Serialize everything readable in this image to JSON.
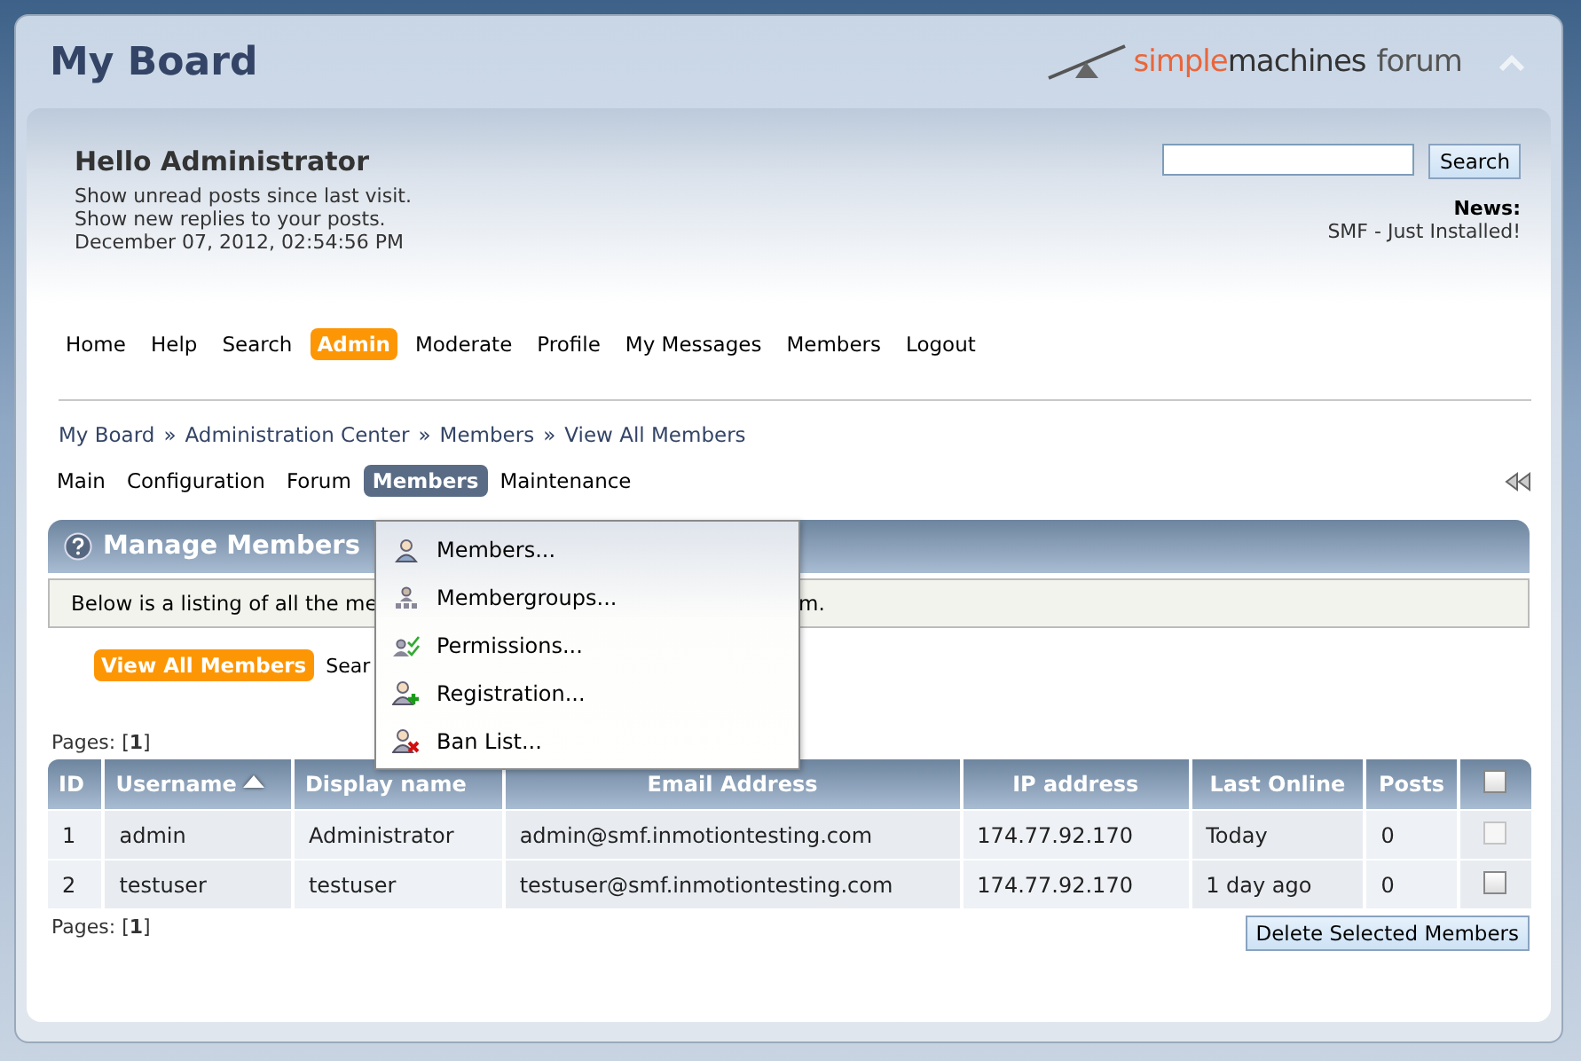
{
  "forum_title": "My Board",
  "logo": {
    "parts": [
      "simple",
      "machines",
      "forum"
    ]
  },
  "user": {
    "greeting": "Hello Administrator",
    "links": [
      "Show unread posts since last visit.",
      "Show new replies to your posts."
    ],
    "date": "December 07, 2012, 02:54:56 PM"
  },
  "search": {
    "button": "Search"
  },
  "news": {
    "label": "News:",
    "text": "SMF - Just Installed!"
  },
  "main_menu": [
    {
      "label": "Home",
      "selected": false
    },
    {
      "label": "Help",
      "selected": false
    },
    {
      "label": "Search",
      "selected": false
    },
    {
      "label": "Admin",
      "selected": true
    },
    {
      "label": "Moderate",
      "selected": false
    },
    {
      "label": "Profile",
      "selected": false
    },
    {
      "label": "My Messages",
      "selected": false
    },
    {
      "label": "Members",
      "selected": false
    },
    {
      "label": "Logout",
      "selected": false
    }
  ],
  "breadcrumb": {
    "separator": "»",
    "items": [
      "My Board",
      "Administration Center",
      "Members",
      "View All Members"
    ]
  },
  "admin_tabs": [
    {
      "label": "Main",
      "selected": false
    },
    {
      "label": "Configuration",
      "selected": false
    },
    {
      "label": "Forum",
      "selected": false
    },
    {
      "label": "Members",
      "selected": true
    },
    {
      "label": "Maintenance",
      "selected": false
    }
  ],
  "dropdown": [
    {
      "label": "Members...",
      "kind": "member"
    },
    {
      "label": "Membergroups...",
      "kind": "group"
    },
    {
      "label": "Permissions...",
      "kind": "permission"
    },
    {
      "label": "Registration...",
      "kind": "add"
    },
    {
      "label": "Ban List...",
      "kind": "ban"
    }
  ],
  "section": {
    "title": "Manage Members",
    "description_parts": [
      "Below is a listing of all the me",
      "m."
    ]
  },
  "subtabs": [
    {
      "label": "View All Members",
      "selected": true
    },
    {
      "label": "Sear",
      "selected": false
    }
  ],
  "pages_top": "Pages: [**1**]",
  "table": {
    "columns": [
      {
        "label": "ID",
        "sorted": false
      },
      {
        "label": "Username",
        "sorted": true
      },
      {
        "label": "Display name",
        "sorted": false
      },
      {
        "label": "Email Address",
        "sorted": false
      },
      {
        "label": "IP address",
        "sorted": false
      },
      {
        "label": "Last Online",
        "sorted": false
      },
      {
        "label": "Posts",
        "sorted": false
      }
    ],
    "select_all": {
      "checked": false
    },
    "rows": [
      {
        "cells": [
          "1",
          "admin",
          "Administrator",
          "admin@smf.inmotiontesting.com",
          "174.77.92.170",
          "Today",
          "0"
        ],
        "checked": false,
        "disabled": true
      },
      {
        "cells": [
          "2",
          "testuser",
          "testuser",
          "testuser@smf.inmotiontesting.com",
          "174.77.92.170",
          "1 day ago",
          "0"
        ],
        "checked": false,
        "disabled": false
      }
    ]
  },
  "pages_bottom": "Pages: [**1**]",
  "delete_button": "Delete Selected Members"
}
